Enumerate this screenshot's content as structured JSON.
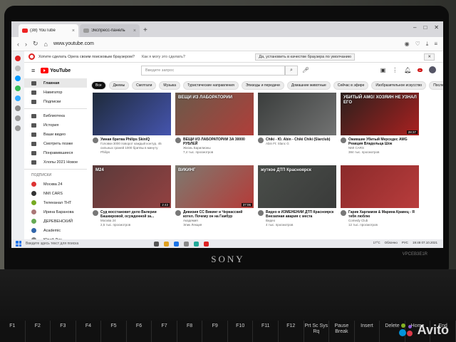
{
  "browser": {
    "tabs": [
      {
        "label": "(38) YouTube",
        "active": true
      },
      {
        "label": "Экспресс-панель",
        "active": false
      }
    ],
    "address": "www.youtube.com",
    "notice": {
      "text": "Хотите сделать Opera своим поисковым браузером?",
      "question": "Как я могу это сделать?",
      "set_default": "Да, установить в качестве браузера по умолчанию"
    },
    "status_url": "https://www.youtube.com"
  },
  "youtube": {
    "logo": "YouTube",
    "search_placeholder": "Введите запрос",
    "notif_count": "9+",
    "sidebar": [
      {
        "label": "Главная",
        "active": true
      },
      {
        "label": "Навигатор"
      },
      {
        "label": "Подписки"
      },
      {
        "label": "Библиотека"
      },
      {
        "label": "История"
      },
      {
        "label": "Ваши видео"
      },
      {
        "label": "Смотреть позже"
      },
      {
        "label": "Понравившиеся"
      },
      {
        "label": "Хлопы 2021 Новое"
      }
    ],
    "subs_header": "ПОДПИСКИ",
    "subscriptions": [
      {
        "label": "Москва 24",
        "color": "#d33"
      },
      {
        "label": "NMI CARS",
        "color": "#333"
      },
      {
        "label": "Телеканал ТНТ",
        "color": "#7a2"
      },
      {
        "label": "Ирина Баранова",
        "color": "#a77"
      },
      {
        "label": "ДЕРЕВЕНСКИЙ",
        "color": "#6a5"
      },
      {
        "label": "Academic",
        "color": "#36a"
      },
      {
        "label": "Юрий Дих",
        "color": "#888"
      }
    ],
    "chips": [
      {
        "label": "Все",
        "active": true
      },
      {
        "label": "Джемы"
      },
      {
        "label": "Смотгали"
      },
      {
        "label": "Музыка"
      },
      {
        "label": "Туристические направления"
      },
      {
        "label": "Эпизоды и передачи"
      },
      {
        "label": "Домашние животные"
      },
      {
        "label": "Сейчас в эфире"
      },
      {
        "label": "Изобразительное искусство"
      },
      {
        "label": "Последние опубл."
      }
    ],
    "videos": [
      {
        "title": "Умная бритва Philips SkinIQ",
        "meta": "Головки 3000 поворот каждый контур, 45 сильных граней 1000 бритвы в минуту",
        "channel": "Philips",
        "overlay": "",
        "duration": "",
        "bg": "#1e2a3a",
        "accent": "#56d"
      },
      {
        "title": "ВЕЩИ ИЗ ЛАБОРАТОРИИ ЗА 30000 РУБЛЕЙ",
        "meta": "Жизнь Барилионы",
        "channel": "7,4 тыс. просмотров",
        "overlay": "ВЕЩИ ИЗ ЛАБОРАТОРИИ",
        "duration": "",
        "bg": "#6a5a4a",
        "accent": "#c33"
      },
      {
        "title": "Chiki - Ю. Abin - Chiki Chiki (Slarclub)",
        "meta": "Abin Ft: Slanc G",
        "channel": "",
        "overlay": "",
        "duration": "",
        "bg": "#3a3d3c",
        "accent": "#888"
      },
      {
        "title": "Ожившие Убитый Мерседес AMG Реакция Владельца Шок",
        "meta": "NMI CARS",
        "channel": "384 тыс. просмотров",
        "overlay": "УБИТЫЙ AMG! ХОЗЯИН НЕ УЗНАЛ ЕГО",
        "duration": "28:37",
        "bg": "#2a1f1c",
        "accent": "#d22"
      },
      {
        "title": "Суд восстановит дело Валерии Башкировой, осужденной за...",
        "meta": "Москва 24",
        "channel": "2,5 тыс. просмотров",
        "overlay": "M24",
        "duration": "2:43",
        "bg": "#5a3a3a",
        "accent": "#a44"
      },
      {
        "title": "Дивизия СС Викинг и Черкасский котел. Почему он на Гамбур",
        "meta": "Академия",
        "channel": "Эпик Лекция",
        "overlay": "ВИКИНГ",
        "duration": "37:06",
        "bg": "#7d7a70",
        "accent": "#c22"
      },
      {
        "title": "Видео в ИЗМЕНЕНИИ ДТП Красноярск Внезапная авария с места",
        "meta": "Видео",
        "channel": "4 тыс. просмотров",
        "overlay": "жуткое ДТП Красноярск",
        "duration": "",
        "bg": "#4a4e4a",
        "accent": "#333"
      },
      {
        "title": "Гарик Харламов & Марина Кравец - Я тебя люблю",
        "meta": "Comedy Club",
        "channel": "12 тыс. просмотров",
        "overlay": "",
        "duration": "",
        "bg": "#8a2a2a",
        "accent": "#c44"
      }
    ]
  },
  "taskbar": {
    "search_placeholder": "Введите здесь текст для поиска",
    "temperature": "17°C",
    "weather": "Облачно",
    "lang": "РУС",
    "time": "19:48",
    "date": "07.10.2021"
  },
  "laptop": {
    "brand": "SONY",
    "model": "VPCEB3E1R"
  },
  "keyboard": {
    "keys": [
      "F1",
      "F2",
      "F3",
      "F4",
      "F5",
      "F6",
      "F7",
      "F8",
      "F9",
      "F10",
      "F11",
      "F12",
      "Prt Sc Sys Rq",
      "Pause Break",
      "Insert",
      "Delete",
      "Home",
      "End"
    ]
  },
  "watermark": "Avito"
}
